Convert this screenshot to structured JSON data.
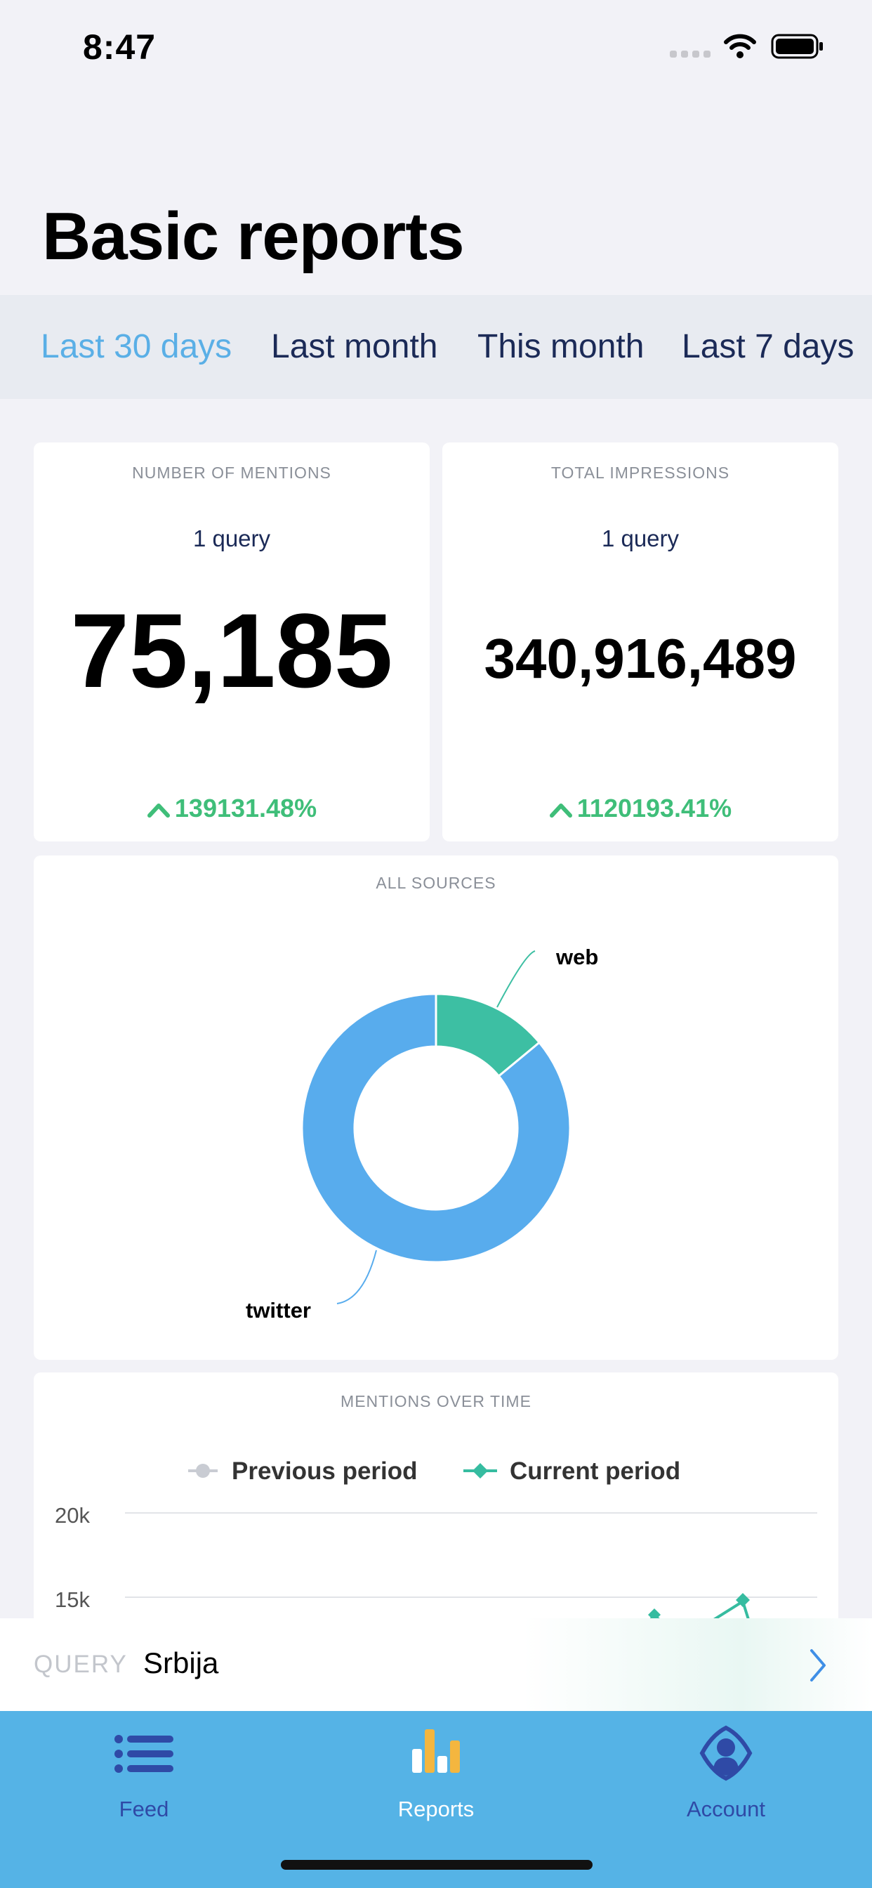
{
  "status_bar": {
    "time": "8:47"
  },
  "page": {
    "title": "Basic reports"
  },
  "tabs": [
    {
      "label": "Last 30 days",
      "active": true
    },
    {
      "label": "Last month",
      "active": false
    },
    {
      "label": "This month",
      "active": false
    },
    {
      "label": "Last 7 days",
      "active": false
    }
  ],
  "mentions_card": {
    "label": "NUMBER OF MENTIONS",
    "query_count": "1 query",
    "value": "75,185",
    "change": "139131.48%",
    "change_direction": "up"
  },
  "impressions_card": {
    "label": "TOTAL IMPRESSIONS",
    "query_count": "1 query",
    "value": "340,916,489",
    "change": "1120193.41%",
    "change_direction": "up"
  },
  "sources_card": {
    "label": "ALL SOURCES",
    "chart_data": {
      "type": "pie",
      "donut": true,
      "slices": [
        {
          "label": "web",
          "value": 14,
          "color": "#3dbfa3"
        },
        {
          "label": "twitter",
          "value": 86,
          "color": "#58aced"
        }
      ]
    }
  },
  "mentions_over_time_card": {
    "label": "MENTIONS OVER TIME",
    "chart_data": {
      "type": "line",
      "legend": [
        "Previous period",
        "Current period"
      ],
      "legend_colors": [
        "#c9ccd3",
        "#36bca0"
      ],
      "y_tick_labels": [
        "20k",
        "15k"
      ],
      "y_ticks": [
        20000,
        15000
      ]
    }
  },
  "query_bar": {
    "label": "QUERY",
    "value": "Srbija"
  },
  "bottom_nav": [
    {
      "label": "Feed",
      "icon": "list-icon",
      "active": false
    },
    {
      "label": "Reports",
      "icon": "bar-chart-icon",
      "active": true
    },
    {
      "label": "Account",
      "icon": "user-shield-icon",
      "active": false
    }
  ],
  "colors": {
    "accent": "#5aafe6",
    "navy": "#1b2a57",
    "positive": "#3fbe79",
    "nav_background": "#55b3e6"
  }
}
